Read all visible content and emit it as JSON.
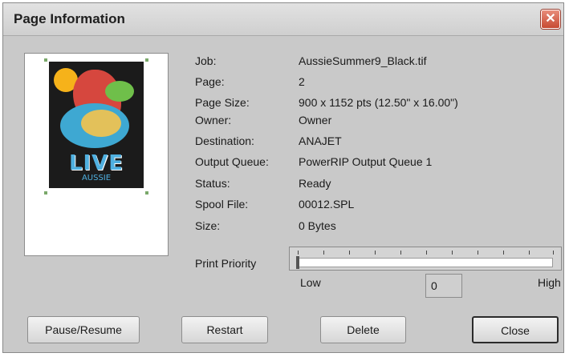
{
  "window": {
    "title": "Page Information",
    "close_icon": "close-icon"
  },
  "info": [
    {
      "label": "Job:",
      "value": "AussieSummer9_Black.tif"
    },
    {
      "label": "Page:",
      "value": "2"
    },
    {
      "label": "Page Size:",
      "value": "900 x 1152 pts (12.50\" x 16.00\")"
    },
    {
      "label": "Owner:",
      "value": "Owner"
    },
    {
      "label": "Destination:",
      "value": "ANAJET"
    },
    {
      "label": "Output Queue:",
      "value": "PowerRIP Output Queue 1"
    },
    {
      "label": "Status:",
      "value": "Ready"
    },
    {
      "label": "Spool File:",
      "value": "00012.SPL"
    },
    {
      "label": "Size:",
      "value": "0 Bytes"
    }
  ],
  "preview": {
    "art_text": "LIVE",
    "art_subtext": "AUSSIE"
  },
  "priority": {
    "label": "Print Priority",
    "low_label": "Low",
    "high_label": "High",
    "value": "0",
    "slider_fraction": 0
  },
  "buttons": {
    "pause_resume": "Pause/Resume",
    "restart": "Restart",
    "delete": "Delete",
    "close": "Close"
  }
}
